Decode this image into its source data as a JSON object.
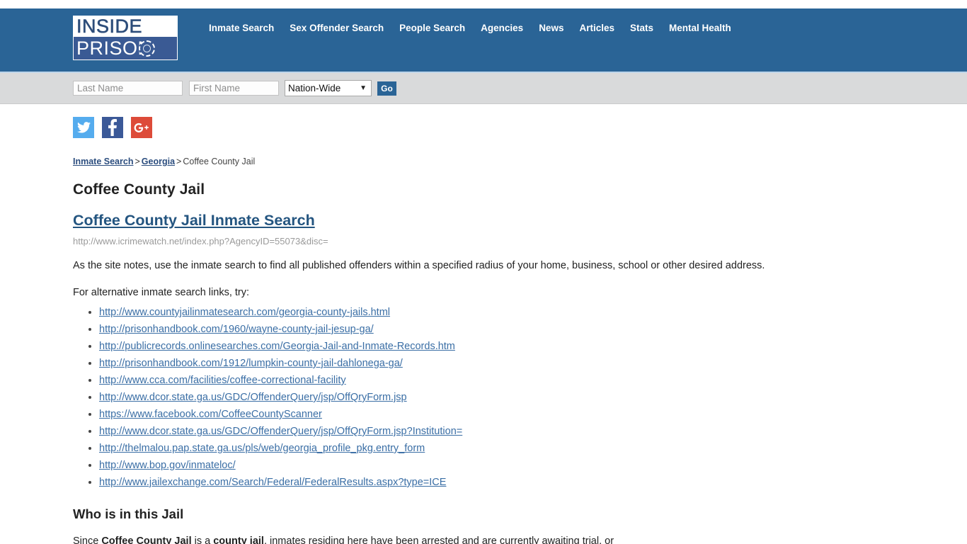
{
  "header": {
    "logo": {
      "line1": "INSIDE",
      "line2": "PRISON",
      "icon": "prison-ring-icon"
    },
    "nav": [
      {
        "label": "Inmate Search"
      },
      {
        "label": "Sex Offender Search"
      },
      {
        "label": "People Search"
      },
      {
        "label": "Agencies"
      },
      {
        "label": "News"
      },
      {
        "label": "Articles"
      },
      {
        "label": "Stats"
      },
      {
        "label": "Mental Health"
      }
    ],
    "brand_color": "#2a6496"
  },
  "search": {
    "last_name_placeholder": "Last Name",
    "last_name_value": "",
    "first_name_placeholder": "First Name",
    "first_name_value": "",
    "region_selected": "Nation-Wide",
    "region_options": [
      "Nation-Wide"
    ],
    "go_label": "Go"
  },
  "social": [
    {
      "name": "twitter-icon",
      "label": "Twitter",
      "color": "#55acee"
    },
    {
      "name": "facebook-icon",
      "label": "Facebook",
      "color": "#3b5998"
    },
    {
      "name": "google-plus-icon",
      "label": "Google Plus",
      "color": "#dd4b39"
    }
  ],
  "breadcrumb": {
    "item1": "Inmate Search",
    "sep1": ">",
    "item2": "Georgia",
    "sep2": ">",
    "current": "Coffee County Jail"
  },
  "main": {
    "page_title": "Coffee County Jail",
    "search_link": "Coffee County Jail Inmate Search",
    "source_url": "http://www.icrimewatch.net/index.php?AgencyID=55073&disc=",
    "intro_paragraph": "As the site notes, use the inmate search to find all published offenders within a specified radius of your home, business, school or other desired address.",
    "alt_links_intro": "For alternative inmate search links, try:",
    "alt_links": [
      "http://www.countyjailinmatesearch.com/georgia-county-jails.html",
      "http://prisonhandbook.com/1960/wayne-county-jail-jesup-ga/",
      "http://publicrecords.onlinesearches.com/Georgia-Jail-and-Inmate-Records.htm",
      "http://prisonhandbook.com/1912/lumpkin-county-jail-dahlonega-ga/",
      "http://www.cca.com/facilities/coffee-correctional-facility",
      "http://www.dcor.state.ga.us/GDC/OffenderQuery/jsp/OffQryForm.jsp",
      "https://www.facebook.com/CoffeeCountyScanner",
      "http://www.dcor.state.ga.us/GDC/OffenderQuery/jsp/OffQryForm.jsp?Institution=",
      "http://thelmalou.pap.state.ga.us/pls/web/georgia_profile_pkg.entry_form",
      "http://www.bop.gov/inmateloc/",
      "http://www.jailexchange.com/Search/Federal/FederalResults.aspx?type=ICE"
    ],
    "section_title": "Who is in this Jail",
    "closing": {
      "pre": "Since ",
      "bold1": "Coffee County Jail",
      "mid": " is a ",
      "bold2": "county jail",
      "post": ", inmates residing here have been arrested and are currently awaiting trial, or"
    }
  }
}
